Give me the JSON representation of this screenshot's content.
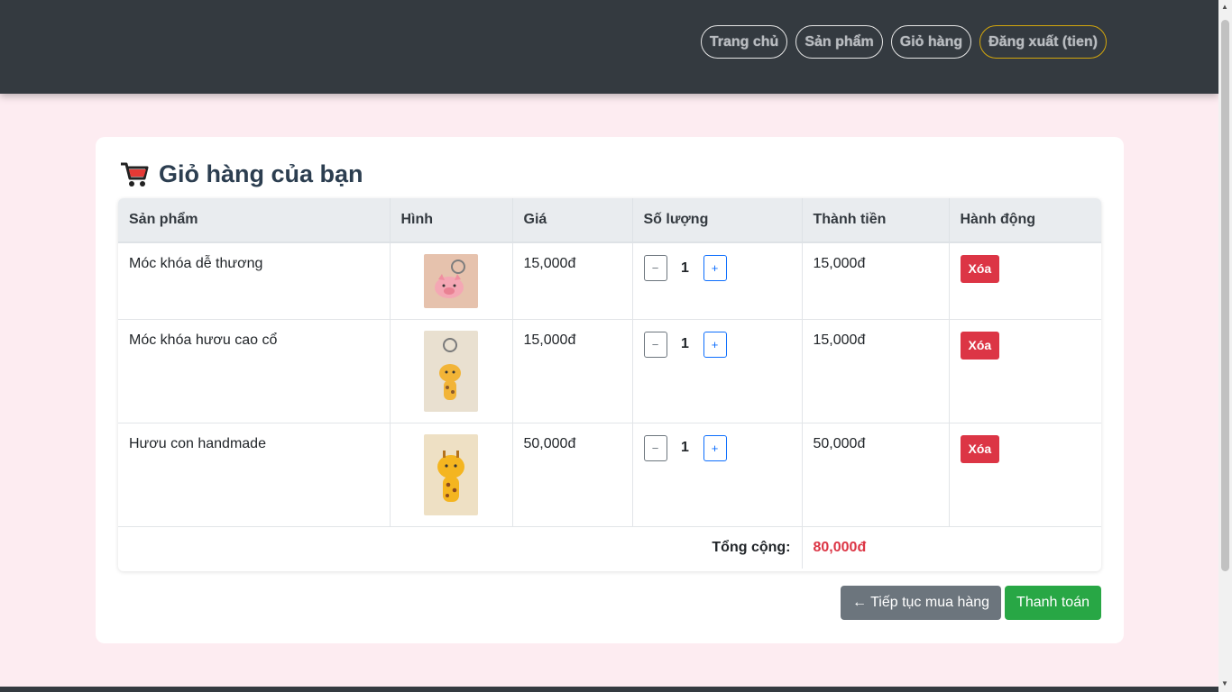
{
  "nav": {
    "items": [
      {
        "label": "Trang chủ"
      },
      {
        "label": "Sản phẩm"
      },
      {
        "label": "Giỏ hàng"
      },
      {
        "label": "Đăng xuất (tien)"
      }
    ]
  },
  "cart": {
    "title": "Giỏ hàng của bạn",
    "icon": "shopping-cart-icon",
    "columns": [
      "Sản phẩm",
      "Hình",
      "Giá",
      "Số lượng",
      "Thành tiền",
      "Hành động"
    ],
    "rows": [
      {
        "name": "Móc khóa dễ thương",
        "price": "15,000đ",
        "qty": "1",
        "subtotal": "15,000đ",
        "delete_label": "Xóa",
        "minus": "−",
        "plus": "+"
      },
      {
        "name": "Móc khóa hươu cao cổ",
        "price": "15,000đ",
        "qty": "1",
        "subtotal": "15,000đ",
        "delete_label": "Xóa",
        "minus": "−",
        "plus": "+"
      },
      {
        "name": "Hươu con handmade",
        "price": "50,000đ",
        "qty": "1",
        "subtotal": "50,000đ",
        "delete_label": "Xóa",
        "minus": "−",
        "plus": "+"
      }
    ],
    "total_label": "Tổng cộng:",
    "total_value": "80,000đ"
  },
  "actions": {
    "continue_label": "← Tiếp tục mua hàng",
    "checkout_label": "Thanh toán"
  },
  "colors": {
    "header_bg": "#343a40",
    "page_bg": "#fdecf1",
    "danger": "#dc3545",
    "success": "#28a745",
    "secondary": "#6c757d",
    "logout_border": "#d4a70c"
  }
}
